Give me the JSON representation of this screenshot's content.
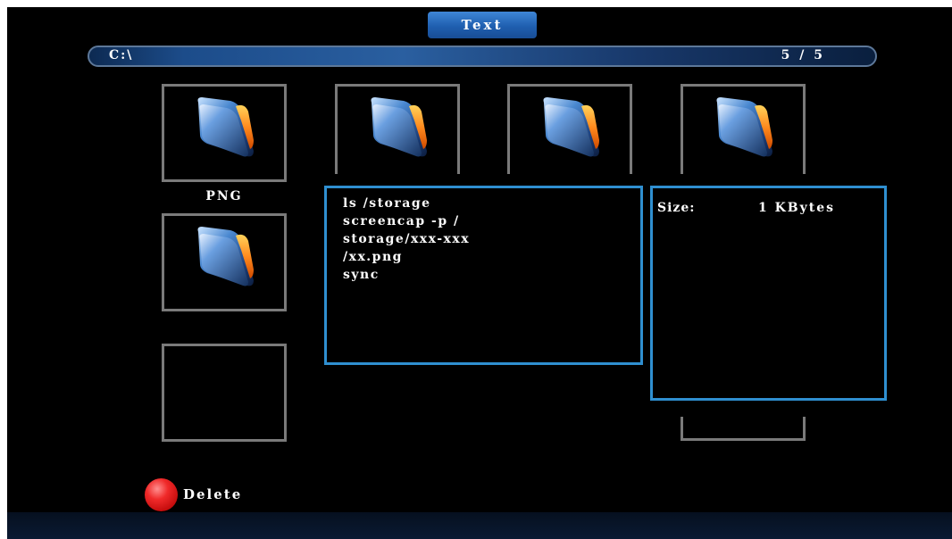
{
  "header": {
    "title": "Text"
  },
  "path_bar": {
    "path": "C:\\",
    "page": "5 / 5"
  },
  "thumbnails": [
    {
      "icon": "folder-icon"
    },
    {
      "icon": "folder-icon"
    },
    {
      "icon": "folder-icon"
    },
    {
      "icon": "folder-icon"
    },
    {
      "icon": "folder-icon"
    },
    {
      "icon": "none"
    },
    {
      "icon": "none"
    }
  ],
  "selected_file": {
    "label": "PNG"
  },
  "text_preview": {
    "lines": [
      "ls /storage",
      "screencap -p /",
      "storage/xxx-xxx",
      "/xx.png",
      "sync"
    ]
  },
  "file_info": {
    "size_label": "Size:",
    "size_value": "1 KBytes"
  },
  "actions": {
    "delete_label": "Delete"
  },
  "colors": {
    "accent_blue": "#2f8fd0",
    "tab_blue": "#1f5fb0",
    "frame_gray": "#7a7a7a",
    "delete_red": "#e0201f",
    "background": "#000000"
  }
}
